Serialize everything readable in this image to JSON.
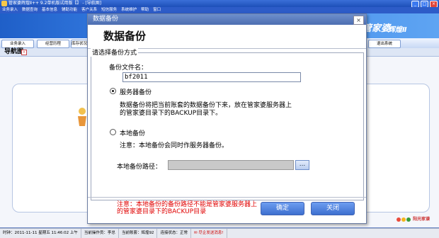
{
  "app": {
    "title": "管家婆辉煌Ⅱ++ 9.2单机版试用版【】 - [导航图]",
    "menu": [
      "业务录入",
      "数据查询",
      "基本信息",
      "辅助功能",
      "客户关系",
      "短信服务",
      "系统维护",
      "帮助",
      "窗口"
    ],
    "brand_a": "管家婆",
    "brand_b": "辉煌Ⅱ",
    "toolbar_items": [
      "业务录入",
      "经营历程",
      "库存状况",
      "退出系统"
    ],
    "nav_tab": "导航图",
    "logo_text": "阳光家谱"
  },
  "statusbar": {
    "time": "时钟：2011-11-11 星期五 11:46:02 上午",
    "operator": "当前操作员：李总",
    "account": "当前账套：辉煌92",
    "connection": "连接状态：正常",
    "alert": "尽企发送消息!"
  },
  "dialog": {
    "window_title": "数据备份",
    "heading": "数据备份",
    "group_label": "请选择备份方式",
    "file_label": "备份文件名：",
    "file_value": "bf2011",
    "server_option": "服务器备份",
    "server_desc_1": "数据备份将把当前账套的数据备份下来，放在管家婆服务器上",
    "server_desc_2": "的管家婆目录下的BACKUP目录下。",
    "local_option": "本地备份",
    "local_note": "注意：本地备份会同时作服务器备份。",
    "path_label": "本地备份路径：",
    "path_value": "",
    "browse_label": "...",
    "warning": "注意：本地备份的备份路径不能是管家婆服务器上的管家婆目录下的BACKUP目录",
    "ok_label": "确定",
    "close_label": "关闭",
    "selected_option": "server"
  },
  "colors": {
    "titlebar": "#4d6eb1",
    "banner": "#3d86ea",
    "button": "#3d6fcf",
    "warning": "#e00000"
  }
}
